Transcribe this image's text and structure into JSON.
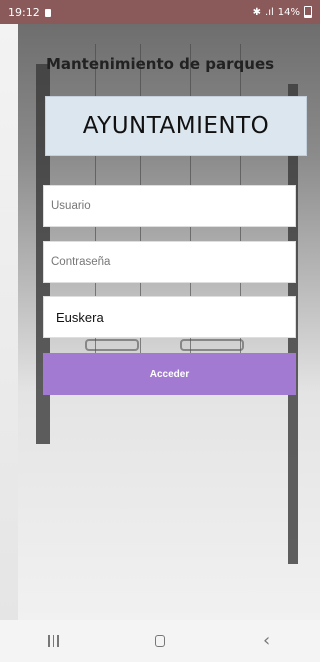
{
  "status_bar": {
    "time": "19:12",
    "battery": "14%",
    "icons": [
      "lock-icon",
      "bluetooth-icon",
      "wifi-calling-icon",
      "signal-icon",
      "battery-icon"
    ]
  },
  "app": {
    "title": "Mantenimiento de parques",
    "badge": "AYUNTAMIENTO"
  },
  "form": {
    "username_placeholder": "Usuario",
    "username_value": "",
    "password_placeholder": "Contraseña",
    "password_value": "",
    "language_selected": "Euskera",
    "submit_label": "Acceder"
  },
  "colors": {
    "accent": "#a27ad2",
    "status_bar": "#8a5a5a",
    "badge_bg": "#dce6ee"
  },
  "nav_bar": {
    "icons": [
      "recent-apps-icon",
      "home-icon",
      "back-icon"
    ]
  }
}
